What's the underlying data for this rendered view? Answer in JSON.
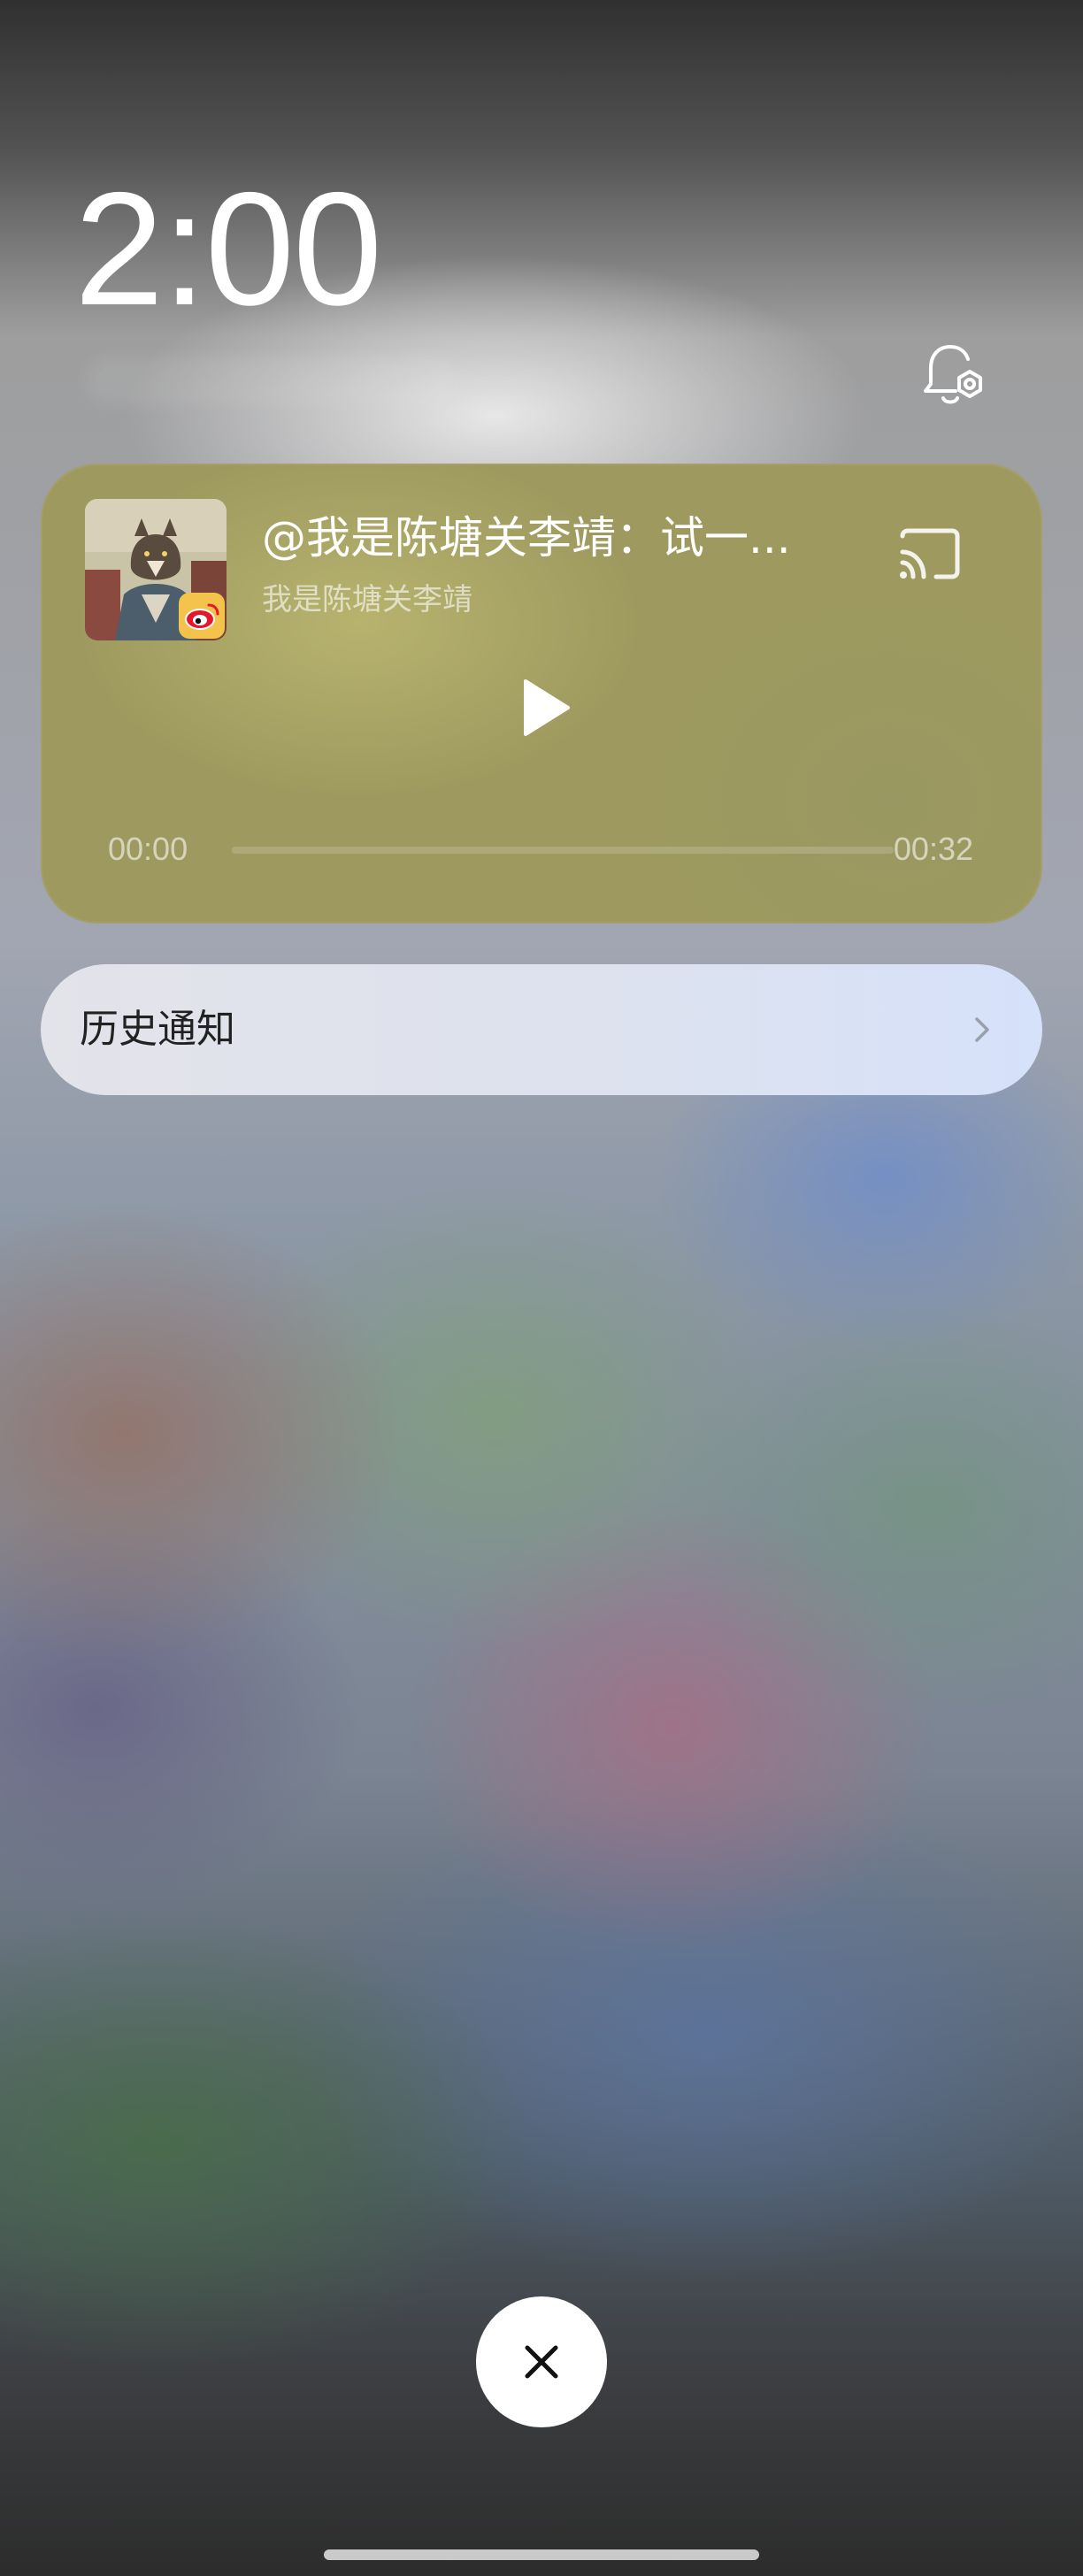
{
  "lockscreen": {
    "time": "2:00"
  },
  "media_card": {
    "title": "@我是陈塘关李靖：试一...",
    "artist": "我是陈塘关李靖",
    "elapsed": "00:00",
    "duration": "00:32",
    "progress_fraction": 0.0,
    "app_icon": "weibo-icon",
    "play_icon": "play-icon",
    "cast_icon": "cast-icon",
    "card_color": "#9e9a5f"
  },
  "history": {
    "label": "历史通知",
    "icon": "chevron-right-icon"
  },
  "actions": {
    "close_icon": "close-icon",
    "settings_icon": "bell-settings-icon"
  }
}
